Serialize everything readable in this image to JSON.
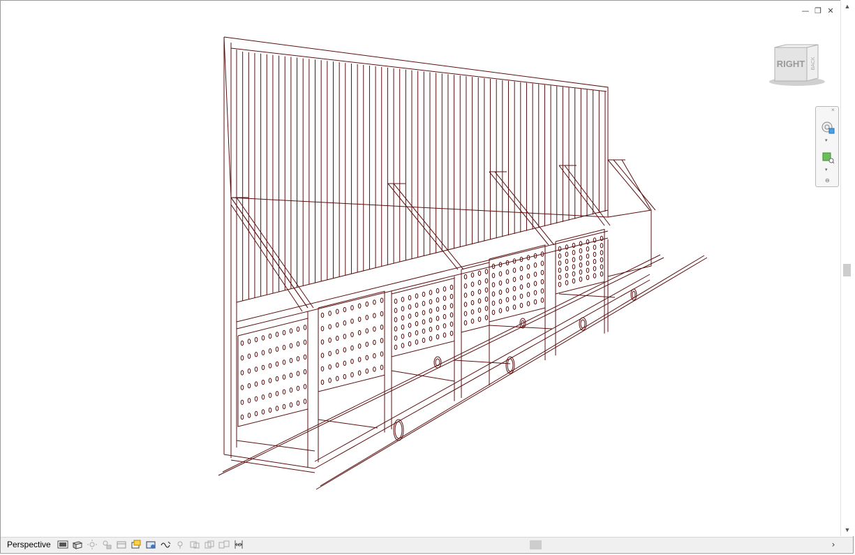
{
  "window": {
    "controls": {
      "minimize_label": "—",
      "restore_label": "❐",
      "close_label": "✕"
    }
  },
  "viewcube": {
    "face_label": "RIGHT",
    "side_label": "BACK"
  },
  "nav_bar": {
    "close_label": "×",
    "dropdown_label": "▾",
    "collapse_label": "⊖"
  },
  "scrollbars": {
    "up_label": "▲",
    "down_label": "▼",
    "left_label": "‹",
    "right_label": "›"
  },
  "status_bar": {
    "view_mode": "Perspective",
    "icons": [
      "detail-level-icon",
      "visual-style-icon",
      "sun-path-icon",
      "shadows-icon",
      "render-icon",
      "crop-view-icon",
      "show-crop-region-icon",
      "unlock-3d-view-icon",
      "temporary-hide-icon",
      "reveal-hidden-icon",
      "temporary-view-properties-icon",
      "hide-analytical-icon",
      "highlight-displacement-icon",
      "reveal-constraints-icon"
    ]
  },
  "colors": {
    "model_line": "#5a0f0f",
    "background": "#ffffff",
    "ui_gray": "#f0f0f0"
  }
}
